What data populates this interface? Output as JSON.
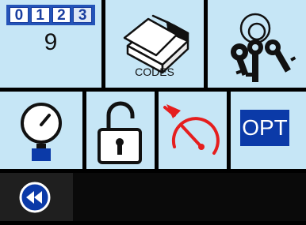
{
  "counter": {
    "digits": [
      "0",
      "1",
      "2",
      "3"
    ],
    "value": "9"
  },
  "codes": {
    "label": "CODES"
  },
  "options": {
    "label": "OPT"
  },
  "icons": {
    "counter": "counter-icon",
    "codes": "eraser-icon",
    "keys": "keys-icon",
    "pressure": "pressure-gauge-icon",
    "unlock": "unlocked-padlock-icon",
    "speed_reset": "speedometer-reset-icon",
    "rewind": "rewind-icon"
  },
  "colors": {
    "tile": "#c6e6f6",
    "background": "#000000",
    "accent_blue": "#0b3aa8",
    "alert_red": "#e51e1e"
  }
}
